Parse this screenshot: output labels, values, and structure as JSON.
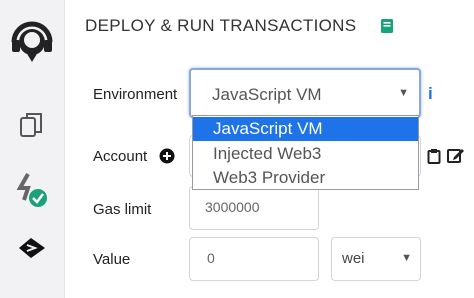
{
  "sidebar": {
    "icons": [
      "remix-logo-icon",
      "file-explorer-icon",
      "compile-check-icon",
      "deploy-run-icon"
    ]
  },
  "panel": {
    "title": "DEPLOY & RUN TRANSACTIONS"
  },
  "environment": {
    "label": "Environment",
    "selected": "JavaScript VM",
    "options": [
      "JavaScript VM",
      "Injected Web3",
      "Web3 Provider"
    ]
  },
  "account": {
    "label": "Account"
  },
  "gas_limit": {
    "label": "Gas limit",
    "value": "3000000"
  },
  "value": {
    "label": "Value",
    "amount": "0",
    "unit": "wei"
  },
  "colors": {
    "accent": "#1e73e8",
    "book": "#1aa37a",
    "check": "#1aa37a"
  }
}
